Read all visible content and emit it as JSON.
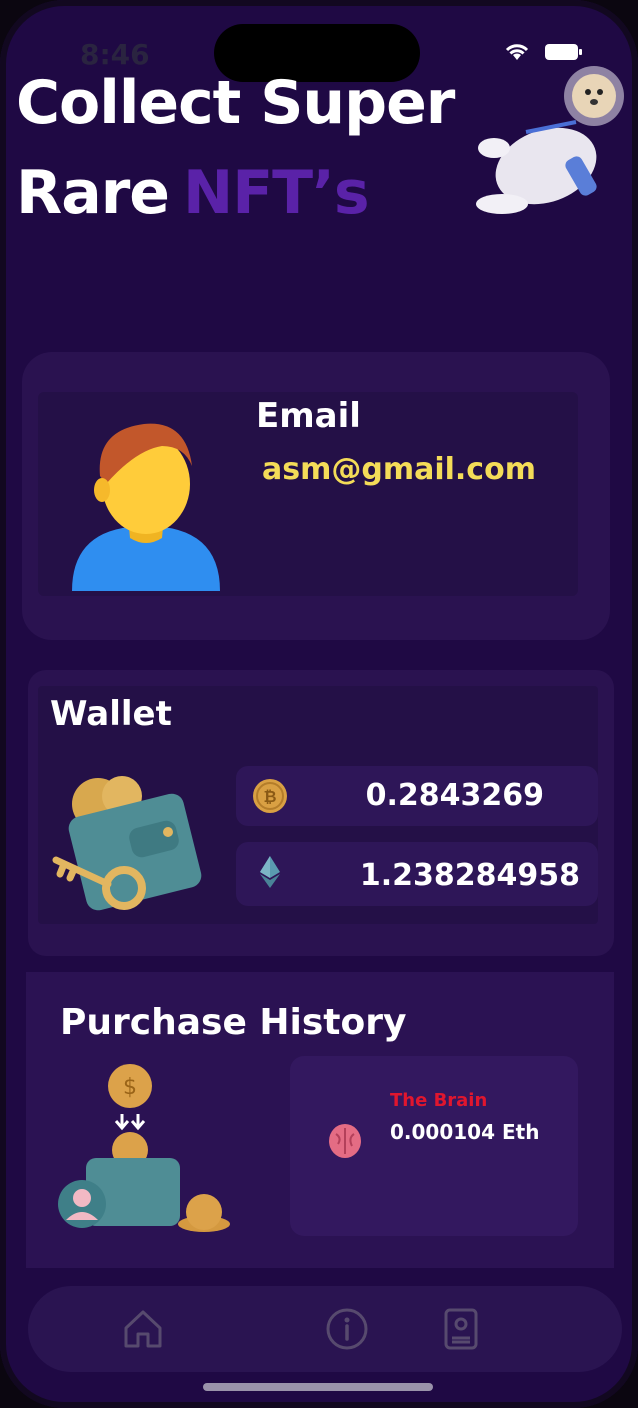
{
  "status_bar": {
    "time": "8:46"
  },
  "header": {
    "line1": "Collect Super",
    "line2": "Rare",
    "accent": "NFT’s"
  },
  "profile": {
    "email_label": "Email",
    "email": "asm@gmail.com"
  },
  "wallet": {
    "title": "Wallet",
    "balances": [
      {
        "icon": "bitcoin-icon",
        "value": "0.2843269"
      },
      {
        "icon": "ethereum-icon",
        "value": "1.238284958"
      }
    ]
  },
  "purchase_history": {
    "title": "Purchase History",
    "items": [
      {
        "icon": "brain-icon",
        "name": "The Brain",
        "price": "0.000104 Eth"
      }
    ]
  },
  "tab_bar": {
    "tabs": [
      "home-icon",
      "info-icon",
      "profile-book-icon"
    ]
  },
  "colors": {
    "background": "#1f0944",
    "accent": "#5a22a8",
    "email": "#f4dc58",
    "item_name": "#e0162e"
  }
}
